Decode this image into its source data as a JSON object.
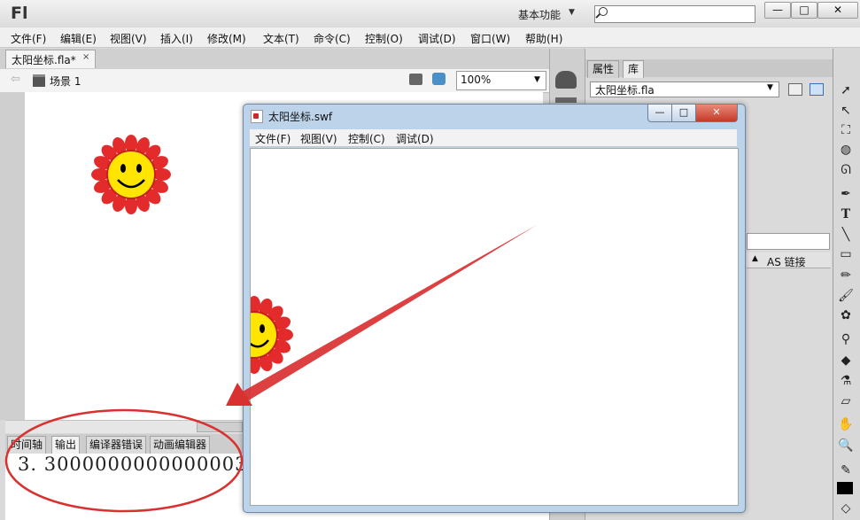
{
  "app": {
    "logo": "Fl",
    "workspace": "基本功能",
    "window_buttons": [
      "—",
      "□",
      "✕"
    ]
  },
  "menu": [
    "文件(F)",
    "编辑(E)",
    "视图(V)",
    "插入(I)",
    "修改(M)",
    "文本(T)",
    "命令(C)",
    "控制(O)",
    "调试(D)",
    "窗口(W)",
    "帮助(H)"
  ],
  "document": {
    "tab_label": "太阳坐标.fla*",
    "tab_close": "×",
    "scene": "场景 1",
    "zoom": "100%"
  },
  "bottom_panel": {
    "tabs": [
      "时间轴",
      "输出",
      "编译器错误",
      "动画编辑器"
    ],
    "active_tab": "输出",
    "output": "3. 3000000000000003"
  },
  "right_panel": {
    "tabs": [
      "属性",
      "库"
    ],
    "active_tab": "库",
    "library_file": "太阳坐标.fla",
    "column_label": "AS 链接"
  },
  "swf_window": {
    "title": "太阳坐标.swf",
    "menu": [
      "文件(F)",
      "视图(V)",
      "控制(C)",
      "调试(D)"
    ],
    "buttons": [
      "—",
      "□",
      "✕"
    ]
  },
  "icons": [
    "search-icon",
    "back-arrow-icon",
    "scene-icon",
    "edit-symbol-icon",
    "edit-scene-icon",
    "sun-icon",
    "arrow-annotation",
    "selection-tool-icon",
    "text-tool-icon",
    "hand-tool-icon",
    "zoom-tool-icon"
  ],
  "colors": {
    "annotation_red": "#d93030",
    "sun_petals": "#e32b2b",
    "sun_face": "#ffe500"
  }
}
